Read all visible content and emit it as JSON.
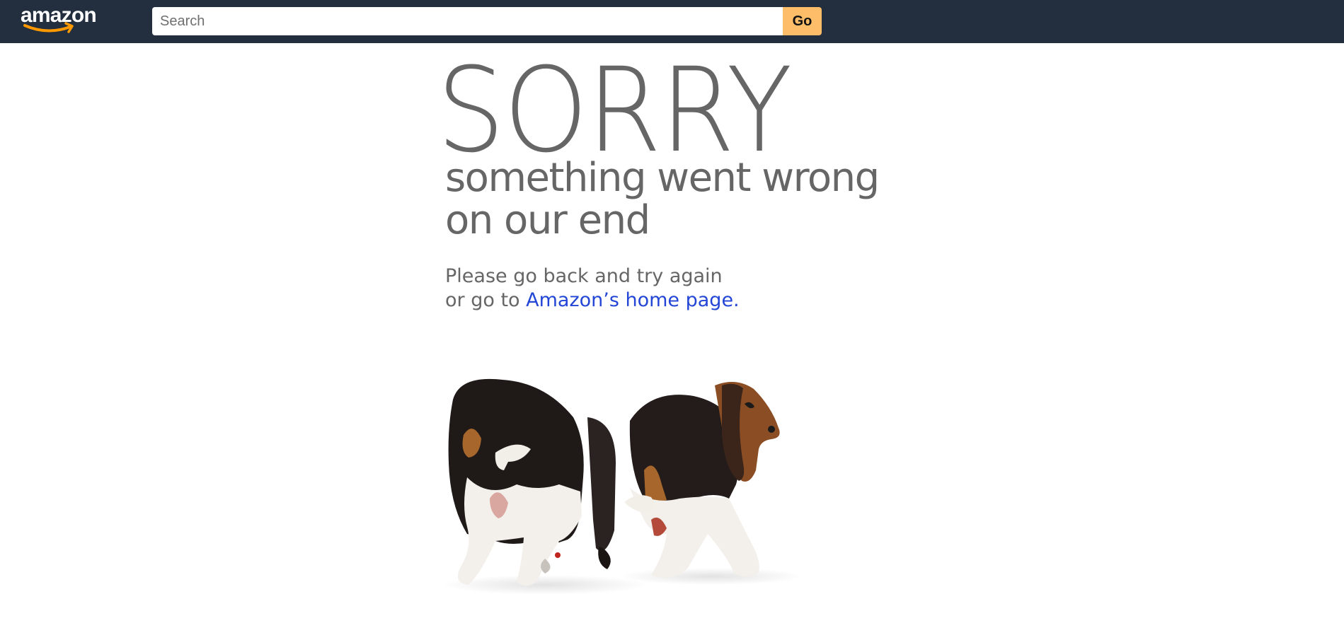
{
  "header": {
    "logo_text": "amazon",
    "search_placeholder": "Search",
    "search_value": "",
    "go_label": "Go",
    "colors": {
      "bar": "#232f3e",
      "button": "#febd69",
      "smile": "#ff9900"
    }
  },
  "error": {
    "headline": "SORRY",
    "subtitle_line1": "something went wrong",
    "subtitle_line2": "on our end",
    "message_line1": "Please go back and try again",
    "message_line2_prefix": "or go to ",
    "home_link_label": "Amazon’s home page.",
    "text_color": "#666666",
    "link_color": "#2346d6"
  },
  "image": {
    "icon": "two-basset-hound-dogs-image"
  }
}
